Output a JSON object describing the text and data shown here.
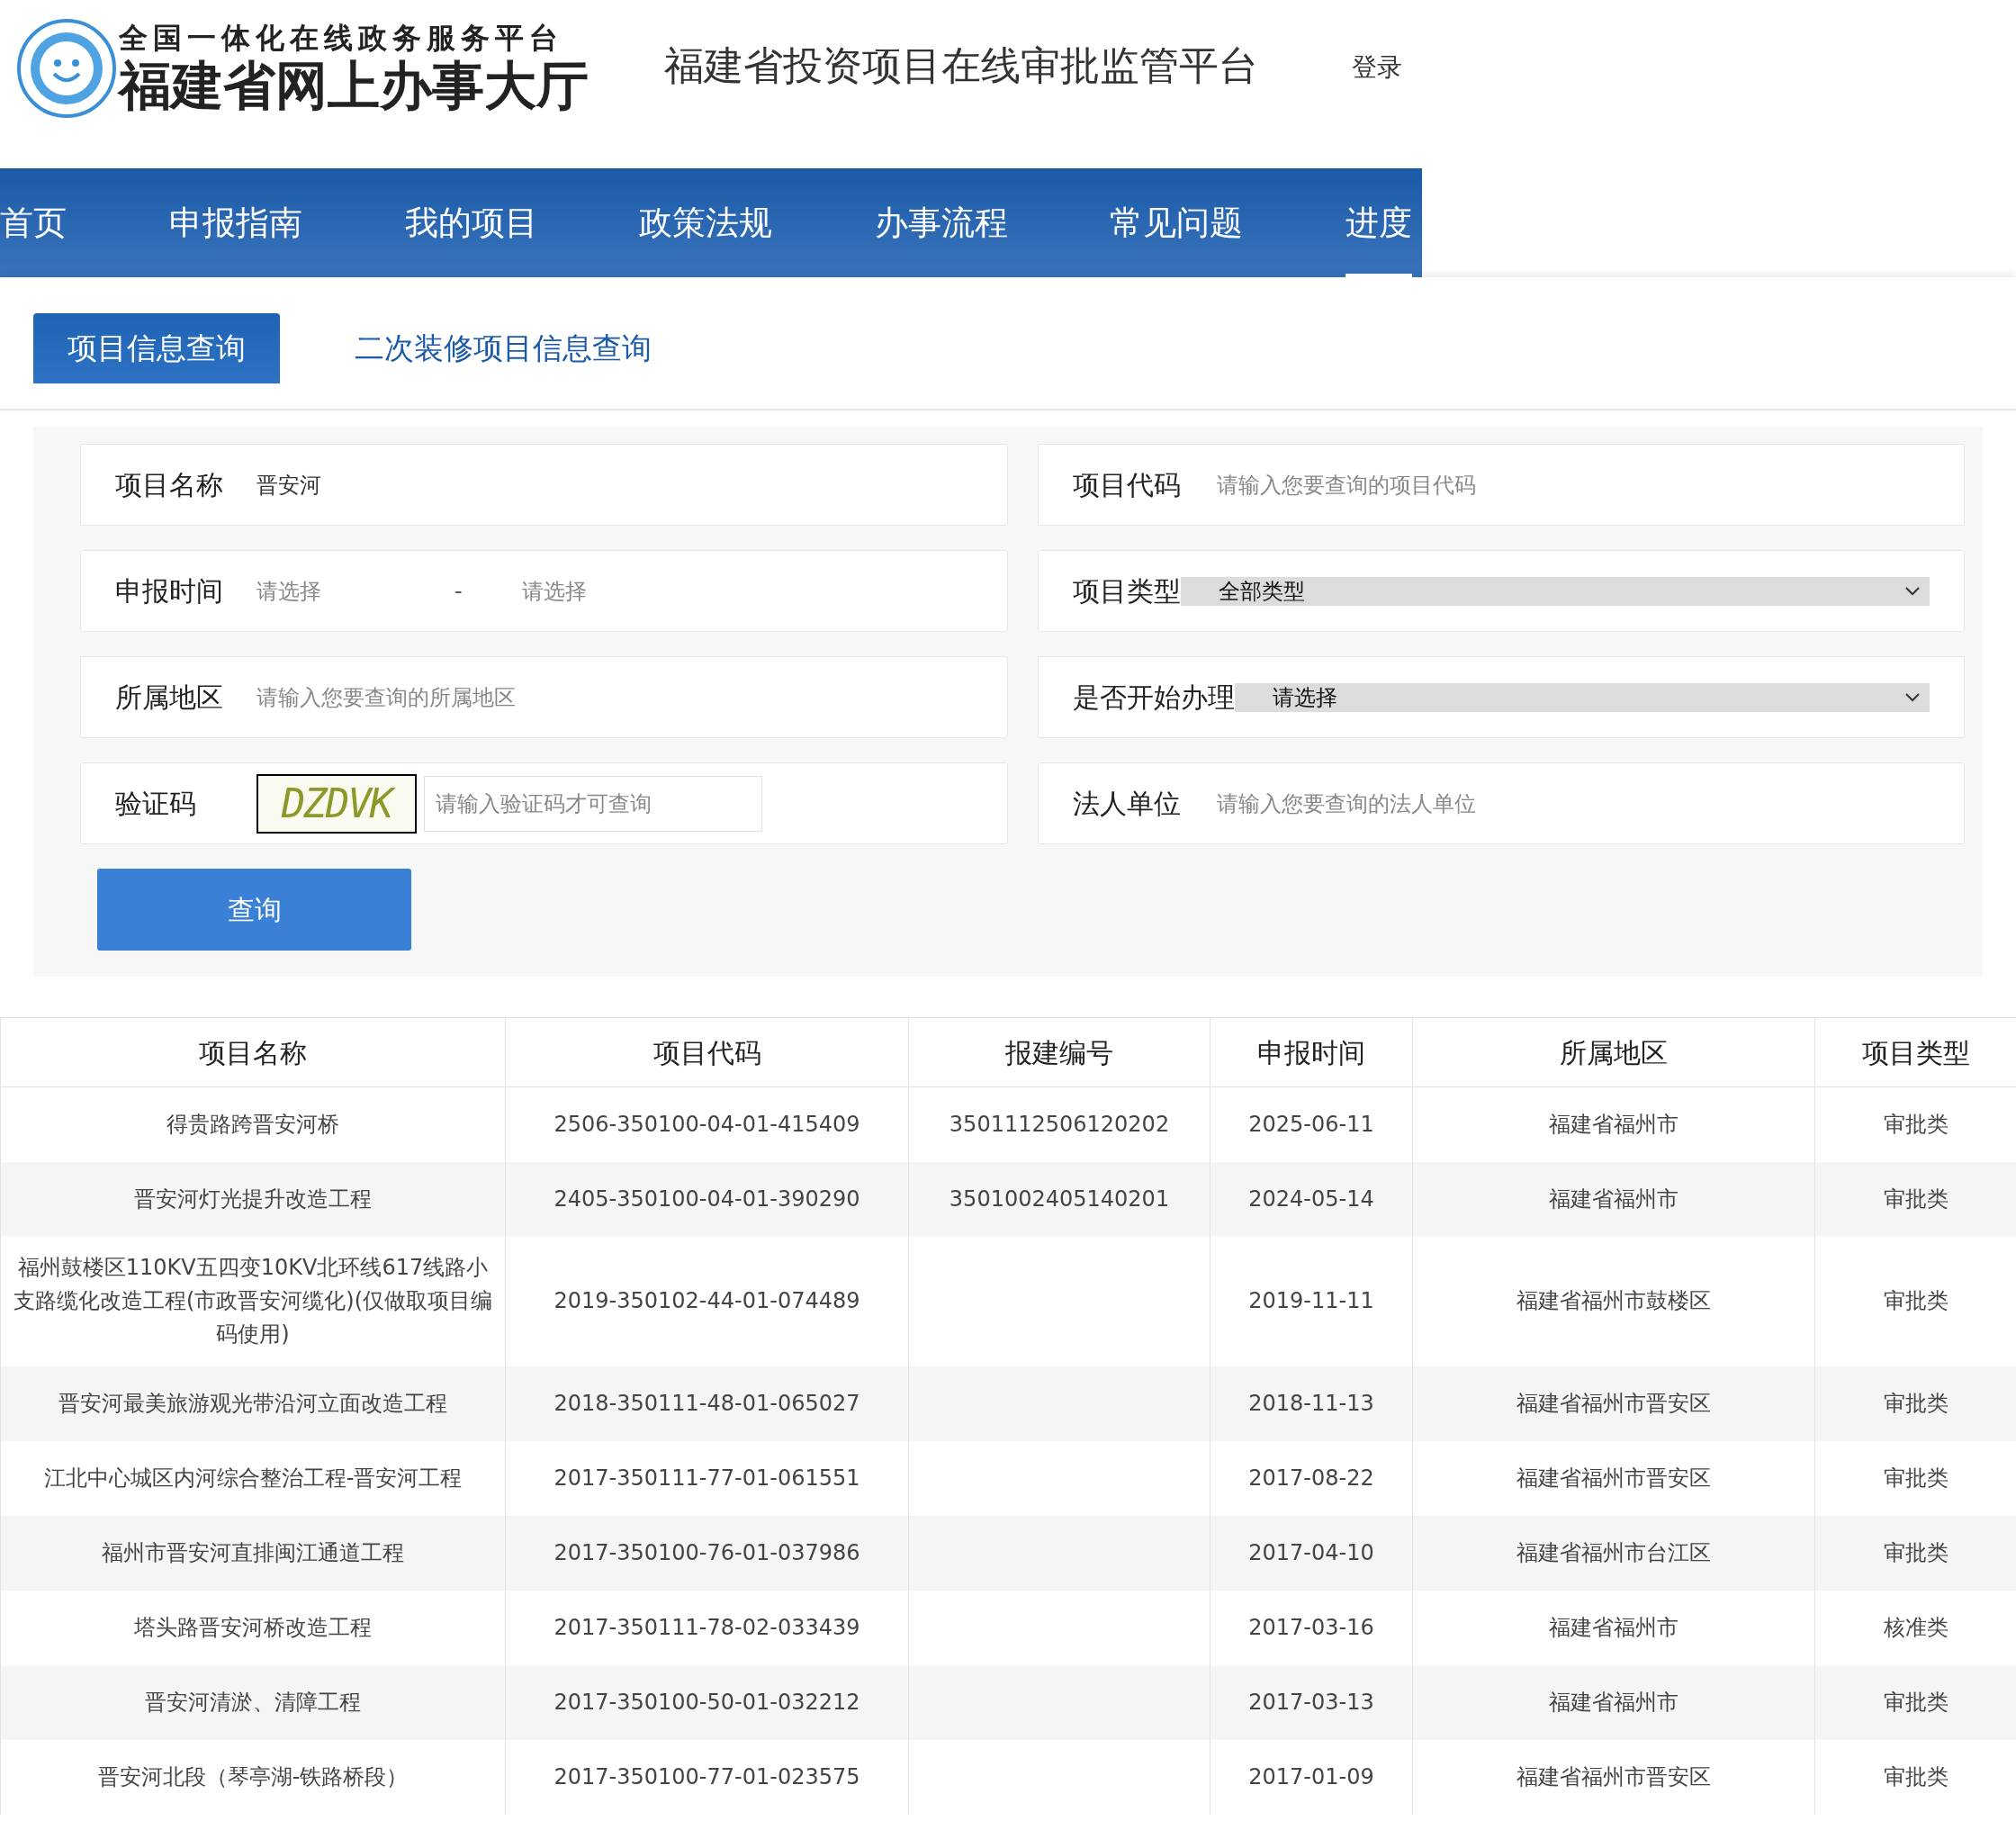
{
  "header": {
    "logo_top": "全国一体化在线政务服务平台",
    "logo_main": "福建省网上办事大厅",
    "title": "福建省投资项目在线审批监管平台",
    "login": "登录"
  },
  "nav": [
    {
      "label": "首页",
      "selected": false
    },
    {
      "label": "申报指南",
      "selected": false
    },
    {
      "label": "我的项目",
      "selected": false
    },
    {
      "label": "政策法规",
      "selected": false
    },
    {
      "label": "办事流程",
      "selected": false
    },
    {
      "label": "常见问题",
      "selected": false
    },
    {
      "label": "进度",
      "selected": true
    }
  ],
  "tabs": [
    {
      "label": "项目信息查询",
      "selected": true
    },
    {
      "label": "二次装修项目信息查询",
      "selected": false
    }
  ],
  "form": {
    "left": [
      {
        "kind": "text",
        "label": "项目名称",
        "value": "晋安河"
      },
      {
        "kind": "range",
        "label": "申报时间",
        "from_placeholder": "请选择",
        "separator": "-",
        "to_placeholder": "请选择"
      },
      {
        "kind": "text",
        "label": "所属地区",
        "placeholder": "请输入您要查询的所属地区"
      },
      {
        "kind": "captcha",
        "label": "验证码",
        "captcha_text": "DZDVK",
        "placeholder": "请输入验证码才可查询"
      }
    ],
    "right": [
      {
        "kind": "text",
        "label": "项目代码",
        "placeholder": "请输入您要查询的项目代码"
      },
      {
        "kind": "select",
        "label": "项目类型",
        "value": "全部类型"
      },
      {
        "kind": "select",
        "label": "是否开始办理",
        "value": "请选择"
      },
      {
        "kind": "text",
        "label": "法人单位",
        "placeholder": "请输入您要查询的法人单位"
      }
    ],
    "submit": "查询"
  },
  "table": {
    "columns": [
      "项目名称",
      "项目代码",
      "报建编号",
      "申报时间",
      "所属地区",
      "项目类型"
    ],
    "rows": [
      [
        "得贵路跨晋安河桥",
        "2506-350100-04-01-415409",
        "3501112506120202",
        "2025-06-11",
        "福建省福州市",
        "审批类"
      ],
      [
        "晋安河灯光提升改造工程",
        "2405-350100-04-01-390290",
        "3501002405140201",
        "2024-05-14",
        "福建省福州市",
        "审批类"
      ],
      [
        "福州鼓楼区110KV五四变10KV北环线617线路小支路缆化改造工程(市政晋安河缆化)(仅做取项目编码使用)",
        "2019-350102-44-01-074489",
        "",
        "2019-11-11",
        "福建省福州市鼓楼区",
        "审批类"
      ],
      [
        "晋安河最美旅游观光带沿河立面改造工程",
        "2018-350111-48-01-065027",
        "",
        "2018-11-13",
        "福建省福州市晋安区",
        "审批类"
      ],
      [
        "江北中心城区内河综合整治工程-晋安河工程",
        "2017-350111-77-01-061551",
        "",
        "2017-08-22",
        "福建省福州市晋安区",
        "审批类"
      ],
      [
        "福州市晋安河直排闽江通道工程",
        "2017-350100-76-01-037986",
        "",
        "2017-04-10",
        "福建省福州市台江区",
        "审批类"
      ],
      [
        "塔头路晋安河桥改造工程",
        "2017-350111-78-02-033439",
        "",
        "2017-03-16",
        "福建省福州市",
        "核准类"
      ],
      [
        "晋安河清淤、清障工程",
        "2017-350100-50-01-032212",
        "",
        "2017-03-13",
        "福建省福州市",
        "审批类"
      ],
      [
        "晋安河北段（琴亭湖-铁路桥段）",
        "2017-350100-77-01-023575",
        "",
        "2017-01-09",
        "福建省福州市晋安区",
        "审批类"
      ]
    ]
  }
}
